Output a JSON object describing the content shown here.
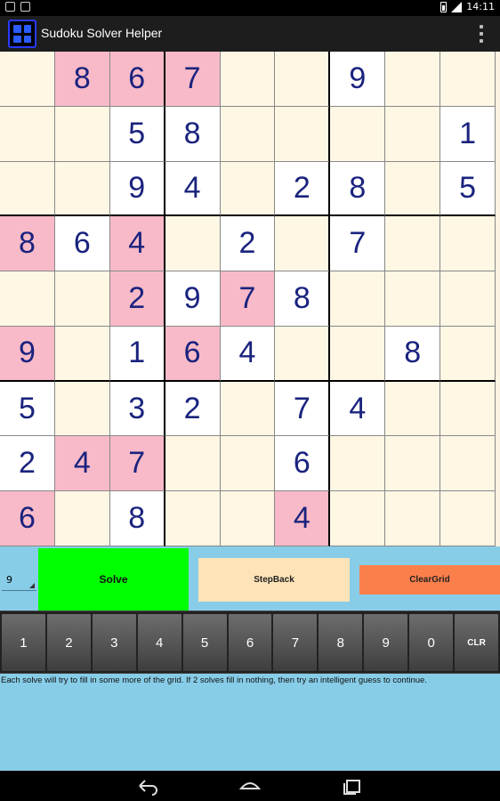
{
  "status_bar": {
    "time": "14:11"
  },
  "action_bar": {
    "title": "Sudoku Solver Helper"
  },
  "board": {
    "cells": [
      [
        "",
        "8",
        "6",
        "7",
        "",
        "",
        "9",
        "",
        ""
      ],
      [
        "",
        "",
        "5",
        "8",
        "",
        "",
        "",
        "",
        "1"
      ],
      [
        "",
        "",
        "9",
        "4",
        "",
        "2",
        "8",
        "",
        "5"
      ],
      [
        "8",
        "6",
        "4",
        "",
        "2",
        "",
        "7",
        "",
        ""
      ],
      [
        "",
        "",
        "2",
        "9",
        "7",
        "8",
        "",
        "",
        ""
      ],
      [
        "9",
        "",
        "1",
        "6",
        "4",
        "",
        "",
        "8",
        ""
      ],
      [
        "5",
        "",
        "3",
        "2",
        "",
        "7",
        "4",
        "",
        ""
      ],
      [
        "2",
        "4",
        "7",
        "",
        "",
        "6",
        "",
        "",
        ""
      ],
      [
        "6",
        "",
        "8",
        "",
        "",
        "4",
        "",
        "",
        ""
      ]
    ],
    "cell_colors": [
      [
        "cream",
        "pink",
        "pink",
        "pink",
        "cream",
        "cream",
        "white",
        "cream",
        "cream"
      ],
      [
        "cream",
        "cream",
        "white",
        "white",
        "cream",
        "cream",
        "cream",
        "cream",
        "white"
      ],
      [
        "cream",
        "cream",
        "white",
        "white",
        "cream",
        "white",
        "white",
        "cream",
        "white"
      ],
      [
        "pink",
        "white",
        "pink",
        "cream",
        "white",
        "cream",
        "white",
        "cream",
        "cream"
      ],
      [
        "cream",
        "cream",
        "pink",
        "white",
        "pink",
        "white",
        "cream",
        "cream",
        "cream"
      ],
      [
        "pink",
        "cream",
        "white",
        "pink",
        "white",
        "cream",
        "cream",
        "white",
        "cream"
      ],
      [
        "white",
        "cream",
        "white",
        "white",
        "cream",
        "white",
        "white",
        "cream",
        "cream"
      ],
      [
        "white",
        "pink",
        "pink",
        "cream",
        "cream",
        "white",
        "cream",
        "cream",
        "cream"
      ],
      [
        "pink",
        "cream",
        "white",
        "cream",
        "cream",
        "pink",
        "cream",
        "cream",
        "cream"
      ]
    ],
    "palette": {
      "cream": "#fdf7e4",
      "white": "#ffffff",
      "pink": "#f8bac8",
      "digit": "#1a237e"
    }
  },
  "controls": {
    "grid_size_value": "9",
    "solve_label": "Solve",
    "stepback_label": "StepBack",
    "cleargrid_label": "ClearGrid",
    "colors": {
      "panel": "#87cde8",
      "solve": "#00ff00",
      "stepback": "#fde4b8",
      "cleargrid": "#fa7f4b"
    }
  },
  "keypad": {
    "keys": [
      "1",
      "2",
      "3",
      "4",
      "5",
      "6",
      "7",
      "8",
      "9",
      "0",
      "CLR"
    ]
  },
  "hint": "Each solve will try to fill in some more of the grid. If 2 solves fill in nothing, then try an intelligent guess to continue.",
  "nav_bar": {
    "icons": [
      "back-icon",
      "home-icon",
      "recent-apps-icon"
    ]
  }
}
